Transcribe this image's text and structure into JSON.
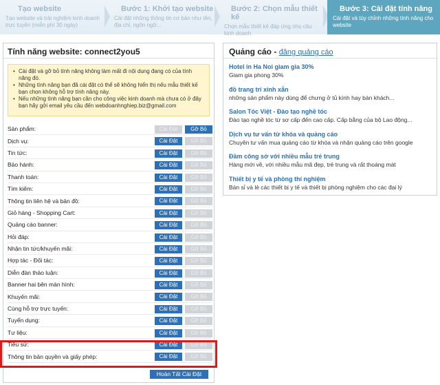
{
  "steps": [
    {
      "title": "Tạo website",
      "desc": "Tạo website và trải nghiệm kinh doanh trực tuyến (miễn phí 30 ngày)",
      "active": false
    },
    {
      "title": "Bước 1: Khởi tạo website",
      "desc": "Cài đặt những thông tin cơ bản như tên, địa chỉ, ngôn ngữ...",
      "active": false
    },
    {
      "title": "Bước 2: Chọn mẫu thiết kế",
      "desc": "Chọn mẫu thiết kế đáp ứng nhu cầu kinh doanh",
      "active": false
    },
    {
      "title": "Bước 3: Cài đặt tính năng",
      "desc": "Cài đặt và tùy chỉnh những tính năng cho website",
      "active": true
    }
  ],
  "left": {
    "title": "Tính năng website: connect2you5",
    "notices": [
      "Cài đặt và gỡ bỏ tính năng không làm mất đi nội dung đang có của tính năng đó.",
      "Những tính năng bạn đã cài đặt có thể sẽ không hiển thị nếu mẫu thiết kế bạn chọn không hỗ trợ tính năng này.",
      "Nếu những tính năng bạn cần cho công việc kinh doanh mà chưa có ở đây bạn hãy gởi email yêu cầu đến webdoanhnghiep.biz@gmail.com"
    ],
    "install_label": "Cài Đặt",
    "remove_label": "Gỡ Bỏ",
    "features": [
      {
        "name": "Sản phẩm:",
        "installed": true
      },
      {
        "name": "Dịch vụ:",
        "installed": false
      },
      {
        "name": "Tin tức:",
        "installed": false
      },
      {
        "name": "Bảo hành:",
        "installed": false
      },
      {
        "name": "Thanh toán:",
        "installed": false
      },
      {
        "name": "Tìm kiếm:",
        "installed": false
      },
      {
        "name": "Thông tin liên hệ và bản đồ:",
        "installed": false
      },
      {
        "name": "Giỏ hàng - Shopping Cart:",
        "installed": false
      },
      {
        "name": "Quảng cáo banner:",
        "installed": false
      },
      {
        "name": "Hỏi đáp:",
        "installed": false
      },
      {
        "name": "Nhận tin tức/khuyến mãi:",
        "installed": false
      },
      {
        "name": "Hợp tác - Đối tác:",
        "installed": false
      },
      {
        "name": "Diễn đàn thảo luận:",
        "installed": false
      },
      {
        "name": "Banner hai bên màn hình:",
        "installed": false
      },
      {
        "name": "Khuyến mãi:",
        "installed": false
      },
      {
        "name": "Cùng hỗ trợ trực tuyến:",
        "installed": false
      },
      {
        "name": "Tuyển dụng:",
        "installed": false
      },
      {
        "name": "Tư liệu:",
        "installed": false
      },
      {
        "name": "Tiểu sử:",
        "installed": false
      },
      {
        "name": "Thông tin bản quyền và giấy phép:",
        "installed": false
      }
    ],
    "finish_label": "Hoàn Tất Cài Đặt"
  },
  "right": {
    "title": "Quảng cáo - ",
    "subtitle": "đăng quảng cáo",
    "ads": [
      {
        "title": "Hotel in Ha Noi giam gia 30%",
        "desc": "Giam gia phong 30%"
      },
      {
        "title": "đồ trang trí xinh xắn",
        "desc": "những sản phẩm này dùng để chưng ở tủ kính hay bàn khách..."
      },
      {
        "title": "Salon Tóc Việt - Đào tạo nghề tóc",
        "desc": "Đào tạo nghề tóc từ sơ cấp đến cao cấp. Cấp bằng của bộ Lao động..."
      },
      {
        "title": "Dịch vụ tư vấn từ khóa và quảng cáo",
        "desc": "Chuyên tư vấn mua quảng cáo từ khóa và nhận quảng cáo trên google"
      },
      {
        "title": "Đầm công sở với nhiều mẫu trẻ trung",
        "desc": "Hàng mới về, với nhiều mẫu mã đẹp, trẻ trung và rất thoáng mát"
      },
      {
        "title": "Thiết bị y tế và phòng thí nghiệm",
        "desc": "Bán sỉ và lẻ các thiết bị y tế và thiết bị phòng nghiệm cho các đại lý"
      }
    ]
  },
  "colors": {
    "accent": "#2d70b5",
    "active_step": "#5ea6bf",
    "highlight": "#e01818",
    "notice_bg": "#fff6cf"
  }
}
